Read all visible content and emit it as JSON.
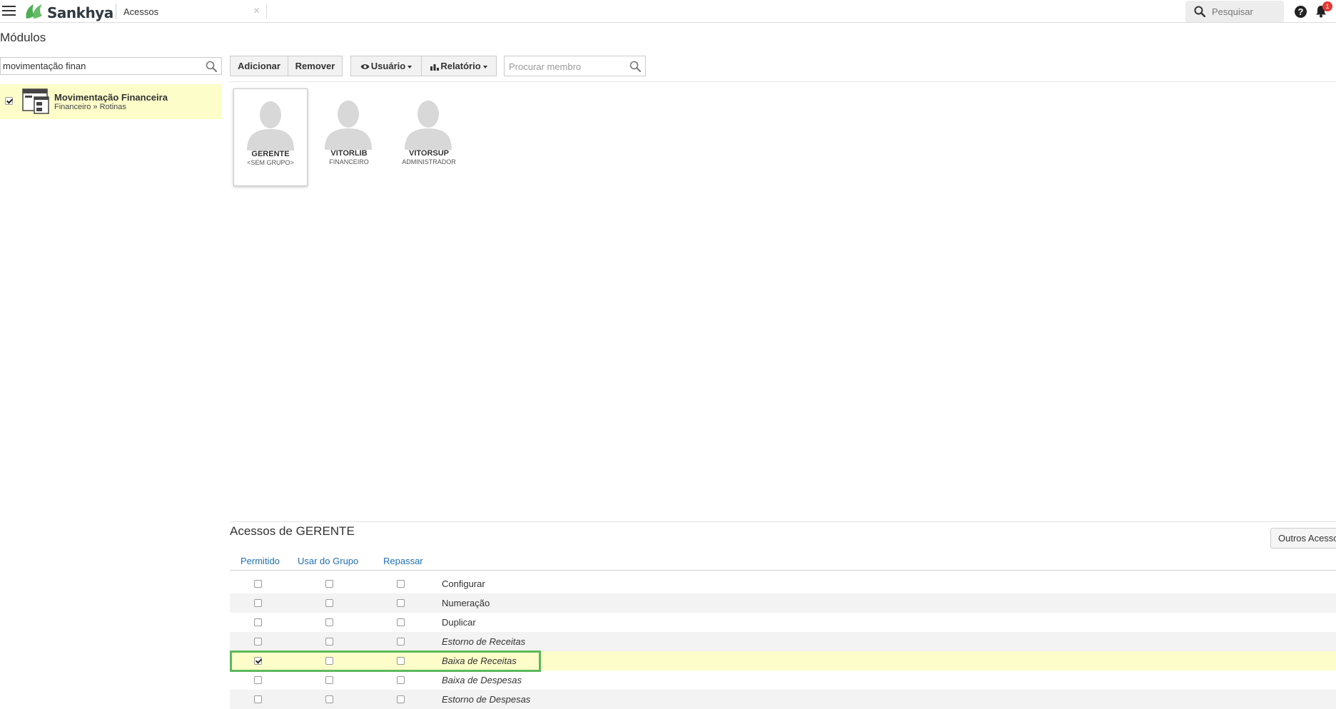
{
  "app": {
    "brand": "Sankhya",
    "tab_title": "Acessos",
    "tab_close": "×",
    "search_placeholder": "Pesquisar",
    "help_label": "?",
    "notification_count": "1",
    "accent_color": "#5cb85c",
    "brand_color": "#4caf50"
  },
  "page": {
    "title": "Módulos"
  },
  "modules": {
    "search_value": "movimentação finan",
    "items": [
      {
        "name": "Movimentação Financeira",
        "path": "Financeiro » Rotinas",
        "checked": true
      }
    ]
  },
  "toolbar": {
    "add_label": "Adicionar",
    "remove_label": "Remover",
    "user_label": "Usuário",
    "report_label": "Relatório",
    "member_search_placeholder": "Procurar membro"
  },
  "users": [
    {
      "name": "GERENTE",
      "group": "<SEM GRUPO>",
      "selected": true
    },
    {
      "name": "VITORLIB",
      "group": "FINANCEIRO",
      "selected": false
    },
    {
      "name": "VITORSUP",
      "group": "ADMINISTRADOR",
      "selected": false
    }
  ],
  "access": {
    "title": "Acessos de GERENTE",
    "other_button": "Outros Acessos",
    "columns": {
      "allowed": "Permitido",
      "group": "Usar do Grupo",
      "pass": "Repassar"
    },
    "rows": [
      {
        "label": "Configurar",
        "allowed": false,
        "group": false,
        "pass": false,
        "italic": false
      },
      {
        "label": "Numeração",
        "allowed": false,
        "group": false,
        "pass": false,
        "italic": false
      },
      {
        "label": "Duplicar",
        "allowed": false,
        "group": false,
        "pass": false,
        "italic": false
      },
      {
        "label": "Estorno de Receitas",
        "allowed": false,
        "group": false,
        "pass": false,
        "italic": true
      },
      {
        "label": "Baixa de Receitas",
        "allowed": true,
        "group": false,
        "pass": false,
        "italic": true,
        "highlighted": true
      },
      {
        "label": "Baixa de Despesas",
        "allowed": false,
        "group": false,
        "pass": false,
        "italic": true
      },
      {
        "label": "Estorno de Despesas",
        "allowed": false,
        "group": false,
        "pass": false,
        "italic": true
      }
    ]
  }
}
